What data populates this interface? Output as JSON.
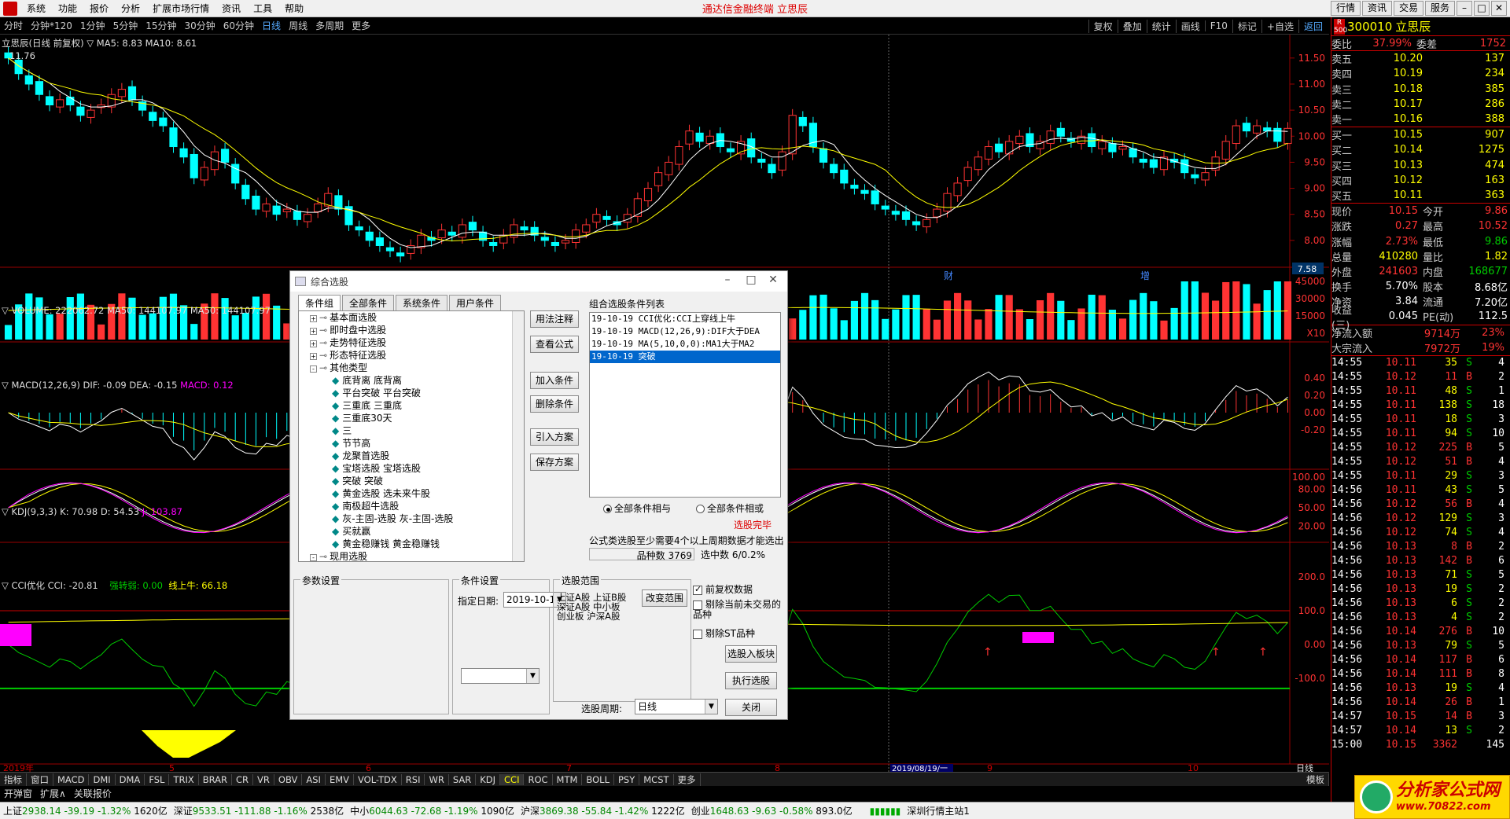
{
  "menubar": {
    "items": [
      "系统",
      "功能",
      "报价",
      "分析",
      "扩展市场行情",
      "资讯",
      "工具",
      "帮助"
    ],
    "center": "通达信金融终端 立思辰",
    "right": [
      "行情",
      "资讯",
      "交易",
      "服务"
    ]
  },
  "periods": [
    "分时",
    "分钟*120",
    "1分钟",
    "5分钟",
    "15分钟",
    "30分钟",
    "60分钟",
    "日线",
    "周线",
    "多周期",
    "更多"
  ],
  "selected_period": "日线",
  "toolbar": [
    "复权",
    "叠加",
    "统计",
    "画线",
    "F10",
    "标记",
    "+自选",
    "返回"
  ],
  "main_title": "立思辰(日线 前复权) ▽ MA5: 8.83 MA10: 8.61",
  "price_marker": "11.76",
  "price_labels": [
    "11.50",
    "11.00",
    "10.50",
    "10.00",
    "9.50",
    "9.00",
    "8.50",
    "8.00"
  ],
  "last_price_box": "7.58",
  "events": [
    "财",
    "增"
  ],
  "vol_title": "▽ VOLUME: 222062.72 MA50: 144107.97 MA50: 144107.97",
  "vol_labels": [
    "45000",
    "30000",
    "15000",
    "X10"
  ],
  "macd_title_a": "▽ MACD(12,26,9) DIF: -0.09 DEA: -0.15",
  "macd_title_b": "MACD: 0.12",
  "macd_labels": [
    "0.40",
    "0.20",
    "0.00",
    "-0.20"
  ],
  "kdj_title_a": "▽ KDJ(9,3,3) K: 70.98 D: 54.53",
  "kdj_title_b": "J: 103.87",
  "kdj_labels": [
    "100.00",
    "80.00",
    "50.00",
    "20.00"
  ],
  "cci_title_a": "▽ CCI优化 CCI: -20.81",
  "cci_title_b": "强转弱: 0.00",
  "cci_title_c": "线上牛: 66.18",
  "cci_labels": [
    "200.0",
    "100.0",
    "0.00",
    "-100.0"
  ],
  "date_axis": {
    "left": "2019年",
    "marks": [
      "5",
      "6",
      "7",
      "8",
      "9",
      "10"
    ],
    "highlight": "2019/08/19/一",
    "right": "日线"
  },
  "right_panel": {
    "code": "300010",
    "name": "立思辰",
    "badge": "R 500",
    "weibi": {
      "l": "委比",
      "v": "37.99%",
      "l2": "委差",
      "v2": "1752"
    },
    "asks": [
      {
        "l": "卖五",
        "p": "10.20",
        "v": "137"
      },
      {
        "l": "卖四",
        "p": "10.19",
        "v": "234"
      },
      {
        "l": "卖三",
        "p": "10.18",
        "v": "385"
      },
      {
        "l": "卖二",
        "p": "10.17",
        "v": "286"
      },
      {
        "l": "卖一",
        "p": "10.16",
        "v": "388"
      }
    ],
    "bids": [
      {
        "l": "买一",
        "p": "10.15",
        "v": "907"
      },
      {
        "l": "买二",
        "p": "10.14",
        "v": "1275"
      },
      {
        "l": "买三",
        "p": "10.13",
        "v": "474"
      },
      {
        "l": "买四",
        "p": "10.12",
        "v": "163"
      },
      {
        "l": "买五",
        "p": "10.11",
        "v": "363"
      }
    ],
    "stats": [
      {
        "a": "现价",
        "b": "10.15",
        "c": "今开",
        "d": "9.86"
      },
      {
        "a": "涨跌",
        "b": "0.27",
        "c": "最高",
        "d": "10.52"
      },
      {
        "a": "涨幅",
        "b": "2.73%",
        "c": "最低",
        "d": "9.86"
      },
      {
        "a": "总量",
        "b": "410280",
        "c": "量比",
        "d": "1.82"
      },
      {
        "a": "外盘",
        "b": "241603",
        "c": "内盘",
        "d": "168677"
      },
      {
        "a": "换手",
        "b": "5.70%",
        "c": "股本",
        "d": "8.68亿"
      },
      {
        "a": "净资",
        "b": "3.84",
        "c": "流通",
        "d": "7.20亿"
      },
      {
        "a": "收益(三)",
        "b": "0.045",
        "c": "PE(动)",
        "d": "112.5"
      }
    ],
    "flows": [
      {
        "l": "净流入额",
        "v": "9714万",
        "p": "23%"
      },
      {
        "l": "大宗流入",
        "v": "7972万",
        "p": "19%"
      }
    ],
    "ticks": [
      [
        "14:55",
        "10.11",
        "35",
        "S",
        "4"
      ],
      [
        "14:55",
        "10.12",
        "11",
        "B",
        "2"
      ],
      [
        "14:55",
        "10.11",
        "48",
        "S",
        "1"
      ],
      [
        "14:55",
        "10.11",
        "138",
        "S",
        "18"
      ],
      [
        "14:55",
        "10.11",
        "18",
        "S",
        "3"
      ],
      [
        "14:55",
        "10.11",
        "94",
        "S",
        "10"
      ],
      [
        "14:55",
        "10.12",
        "225",
        "B",
        "5"
      ],
      [
        "14:55",
        "10.12",
        "51",
        "B",
        "4"
      ],
      [
        "14:55",
        "10.11",
        "29",
        "S",
        "3"
      ],
      [
        "14:56",
        "10.11",
        "43",
        "S",
        "5"
      ],
      [
        "14:56",
        "10.12",
        "56",
        "B",
        "4"
      ],
      [
        "14:56",
        "10.12",
        "129",
        "S",
        "3"
      ],
      [
        "14:56",
        "10.12",
        "74",
        "S",
        "4"
      ],
      [
        "14:56",
        "10.13",
        "8",
        "B",
        "2"
      ],
      [
        "14:56",
        "10.13",
        "142",
        "B",
        "6"
      ],
      [
        "14:56",
        "10.13",
        "71",
        "S",
        "5"
      ],
      [
        "14:56",
        "10.13",
        "19",
        "S",
        "2"
      ],
      [
        "14:56",
        "10.13",
        "6",
        "S",
        "2"
      ],
      [
        "14:56",
        "10.13",
        "4",
        "S",
        "2"
      ],
      [
        "14:56",
        "10.14",
        "276",
        "B",
        "10"
      ],
      [
        "14:56",
        "10.13",
        "79",
        "S",
        "5"
      ],
      [
        "14:56",
        "10.14",
        "117",
        "B",
        "6"
      ],
      [
        "14:56",
        "10.14",
        "111",
        "B",
        "8"
      ],
      [
        "14:56",
        "10.13",
        "19",
        "S",
        "4"
      ],
      [
        "14:56",
        "10.14",
        "26",
        "B",
        "1"
      ],
      [
        "14:57",
        "10.15",
        "14",
        "B",
        "3"
      ],
      [
        "14:57",
        "10.14",
        "13",
        "S",
        "2"
      ],
      [
        "15:00",
        "10.15",
        "3362",
        "",
        "145"
      ]
    ]
  },
  "ind_tabs": [
    "指标",
    "窗口",
    "MACD",
    "DMI",
    "DMA",
    "FSL",
    "TRIX",
    "BRAR",
    "CR",
    "VR",
    "OBV",
    "ASI",
    "EMV",
    "VOL-TDX",
    "RSI",
    "WR",
    "SAR",
    "KDJ",
    "CCI",
    "ROC",
    "MTM",
    "BOLL",
    "PSY",
    "MCST",
    "更多"
  ],
  "ind_right": "模板",
  "tools_row": [
    "开弹窗",
    "扩展∧",
    "关联报价"
  ],
  "statusbar": [
    {
      "n": "上证",
      "v": "2938.14",
      "c": "-39.19",
      "p": "-1.32%",
      "a": "1620亿"
    },
    {
      "n": "深证",
      "v": "9533.51",
      "c": "-111.88",
      "p": "-1.16%",
      "a": "2538亿"
    },
    {
      "n": "中小",
      "v": "6044.63",
      "c": "-72.68",
      "p": "-1.19%",
      "a": "1090亿"
    },
    {
      "n": "沪深",
      "v": "3869.38",
      "c": "-55.84",
      "p": "-1.42%",
      "a": "1222亿"
    },
    {
      "n": "创业",
      "v": "1648.63",
      "c": "-9.63",
      "p": "-0.58%",
      "a": "893.0亿"
    }
  ],
  "status_site": "深圳行情主站1",
  "dialog": {
    "title": "综合选股",
    "tabs": [
      "条件组",
      "全部条件",
      "系统条件",
      "用户条件"
    ],
    "tree": [
      {
        "t": "基本面选股",
        "lv": 0,
        "ex": "+"
      },
      {
        "t": "即时盘中选股",
        "lv": 0,
        "ex": "+"
      },
      {
        "t": "走势特征选股",
        "lv": 0,
        "ex": "+"
      },
      {
        "t": "形态特征选股",
        "lv": 0,
        "ex": "+"
      },
      {
        "t": "其他类型",
        "lv": 0,
        "ex": "-"
      },
      {
        "t": "底背离 底背离",
        "lv": 1
      },
      {
        "t": "平台突破 平台突破",
        "lv": 1
      },
      {
        "t": "三重底 三重底",
        "lv": 1
      },
      {
        "t": "三重底30天",
        "lv": 1
      },
      {
        "t": "三",
        "lv": 1
      },
      {
        "t": "节节高",
        "lv": 1
      },
      {
        "t": "龙聚首选股",
        "lv": 1
      },
      {
        "t": "宝塔选股 宝塔选股",
        "lv": 1
      },
      {
        "t": "突破 突破",
        "lv": 1
      },
      {
        "t": "黄金选股 选未来牛股",
        "lv": 1
      },
      {
        "t": "南极超牛选股",
        "lv": 1
      },
      {
        "t": "灰-主固-选股 灰-主固-选股",
        "lv": 1
      },
      {
        "t": "买就赢",
        "lv": 1
      },
      {
        "t": "黄金稳赚钱 黄金稳赚钱",
        "lv": 1
      },
      {
        "t": "现用选股",
        "lv": 0,
        "ex": "-"
      }
    ],
    "btns": [
      "用法注释",
      "查看公式",
      "加入条件",
      "删除条件",
      "引入方案",
      "保存方案"
    ],
    "list_title": "组合选股条件列表",
    "conds": [
      "19-10-19 CCI优化:CCI上穿线上牛",
      "19-10-19 MACD(12,26,9):DIF大于DEA",
      "19-10-19 MA(5,10,0,0):MA1大于MA2",
      "19-10-19 突破"
    ],
    "radio_and": "全部条件相与",
    "radio_or": "全部条件相或",
    "done": "选股完毕",
    "note": "公式类选股至少需要4个以上周期数据才能选出",
    "count": "品种数",
    "count_v": "3769",
    "selected": "选中数 6/0.2%",
    "grp_param": "参数设置",
    "grp_cond": "条件设置",
    "date_label": "指定日期:",
    "date_value": "2019-10-19",
    "grp_range": "选股范围",
    "range_text": [
      "上证A股 上证B股",
      "深证A股 中小板",
      "创业板 沪深A股"
    ],
    "change_range": "改变范围",
    "chk_fq": "前复权数据",
    "chk_tp": "剔除当前未交易的品种",
    "chk_st": "剔除ST品种",
    "btn_block": "选股入板块",
    "btn_run": "执行选股",
    "btn_close": "关闭",
    "period_label": "选股周期:",
    "period_value": "日线"
  },
  "watermark": {
    "main": "分析家公式网",
    "sub": "www.70822.com"
  }
}
